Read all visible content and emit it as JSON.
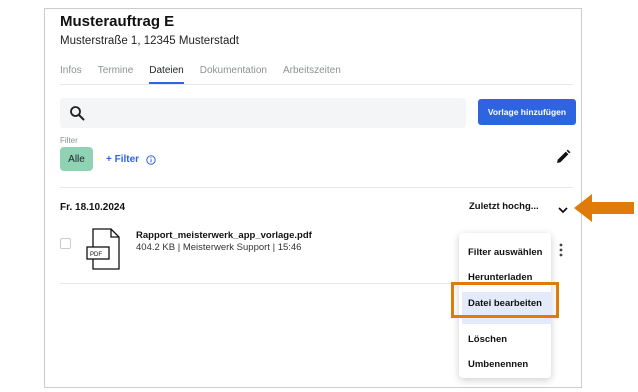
{
  "header": {
    "title": "Musterauftrag E",
    "address": "Musterstraße 1, 12345 Musterstadt"
  },
  "tabs": [
    {
      "label": "Infos",
      "active": false
    },
    {
      "label": "Termine",
      "active": false
    },
    {
      "label": "Dateien",
      "active": true
    },
    {
      "label": "Dokumentation",
      "active": false
    },
    {
      "label": "Arbeitszeiten",
      "active": false
    }
  ],
  "search": {
    "icon": "search-icon"
  },
  "toolbar": {
    "add_template_label": "Vorlage hinzufügen"
  },
  "filter": {
    "label": "Filter",
    "chip_all": "Alle",
    "add_filter_label": "+ Filter"
  },
  "files": {
    "date": "Fr. 18.10.2024",
    "sort_label": "Zuletzt hochg...",
    "items": [
      {
        "name": "Rapport_meisterwerk_app_vorlage.pdf",
        "info": "404.2 KB | Meisterwerk Support | 15:46",
        "type_label": "PDF"
      }
    ]
  },
  "context_menu": {
    "items": [
      {
        "label": "Filter auswählen"
      },
      {
        "label": "Herunterladen"
      },
      {
        "label": "Datei bearbeiten",
        "highlighted": true
      },
      {
        "label": "Löschen"
      },
      {
        "label": "Umbenennen"
      }
    ]
  },
  "colors": {
    "accent": "#2f64e0",
    "chip": "#8fd3b4",
    "highlight_box": "#e07b0a",
    "menu_highlight": "#e3ebfb"
  }
}
